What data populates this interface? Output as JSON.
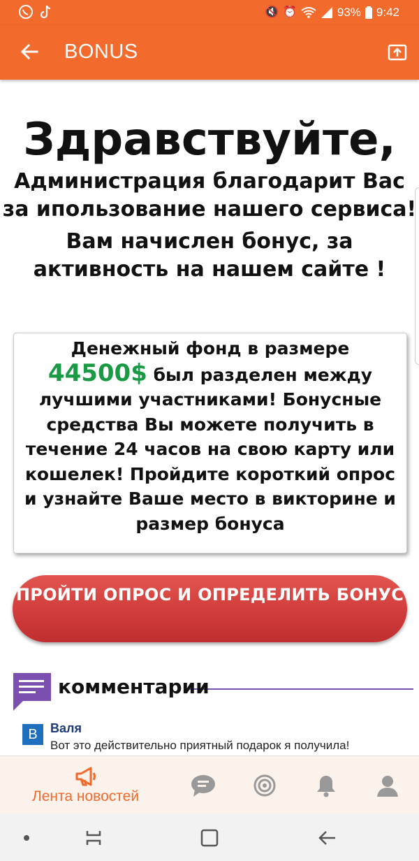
{
  "status_bar": {
    "battery": "93%",
    "time": "9:42",
    "left_icons": [
      "viber-icon",
      "tiktok-icon"
    ],
    "right_icons": [
      "mute-icon",
      "alarm-icon",
      "wifi-icon",
      "signal-icon",
      "battery-icon"
    ]
  },
  "app_bar": {
    "title": "BONUS"
  },
  "headline": {
    "greeting": "Здравствуйте,",
    "admin_text": "Администрация благодарит Вас за ипользование нашего сервиса!",
    "bonus_text": "Вам начислен бонус, за активность на нашем сайте !"
  },
  "info_box": {
    "line_before": "Денежный фонд в размере",
    "amount": "44500$",
    "line_after": " был разделен между лучшими участниками! Бонусные средства Вы можете получить в течение 24 часов на свою карту или кошелек! Пройдите короткий опрос и узнайте Ваше место в викторине и размер бонуса"
  },
  "cta": {
    "label": "ПРОЙТИ ОПРОС И ОПРЕДЕЛИТЬ БОНУС"
  },
  "comments": {
    "title": "комментарии",
    "items": [
      {
        "avatar_letter": "В",
        "author": "Валя",
        "text": "Вот это действительно приятный подарок я получила!"
      }
    ]
  },
  "bottom_nav": {
    "items": [
      {
        "label": "Лента новостей",
        "icon": "megaphone-icon",
        "active": true
      },
      {
        "label": "",
        "icon": "chat-icon"
      },
      {
        "label": "",
        "icon": "target-icon"
      },
      {
        "label": "",
        "icon": "bell-icon"
      },
      {
        "label": "",
        "icon": "user-icon"
      }
    ]
  },
  "colors": {
    "brand_orange": "#f26a2c",
    "amount_green": "#1a9a45",
    "cta_red": "#cf3a3a",
    "comments_purple": "#7b4fb0"
  }
}
